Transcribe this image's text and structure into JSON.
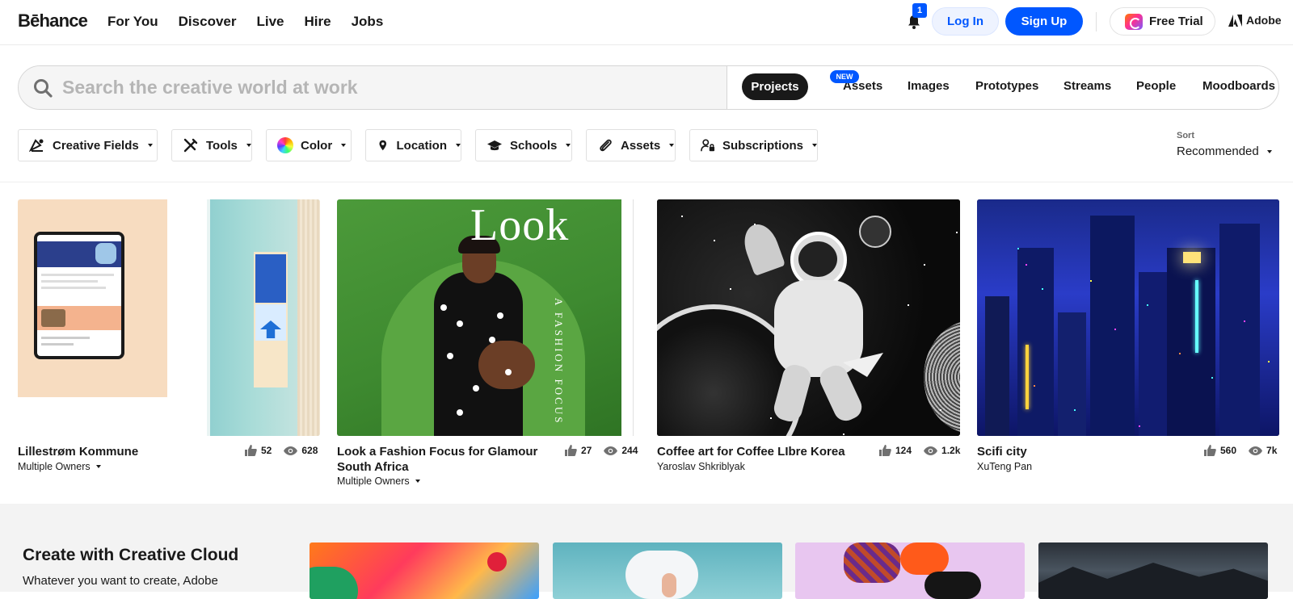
{
  "nav": {
    "logo": "Bēhance",
    "links": [
      "For You",
      "Discover",
      "Live",
      "Hire",
      "Jobs"
    ],
    "notification_count": "1",
    "login_label": "Log In",
    "signup_label": "Sign Up",
    "trial_label": "Free Trial",
    "adobe_label": "Adobe"
  },
  "search": {
    "placeholder": "Search the creative world at work",
    "tabs": [
      "Projects",
      "Assets",
      "Images",
      "Prototypes",
      "Streams",
      "People",
      "Moodboards"
    ],
    "active_tab": "Projects",
    "new_badge": "NEW"
  },
  "filters": [
    "Creative Fields",
    "Tools",
    "Color",
    "Location",
    "Schools",
    "Assets",
    "Subscriptions"
  ],
  "sort": {
    "label": "Sort",
    "value": "Recommended"
  },
  "cards": [
    {
      "title": "Lillestrøm Kommune",
      "owner": "Multiple Owners",
      "owner_dropdown": true,
      "likes": "52",
      "views": "628"
    },
    {
      "title": "Look a Fashion Focus for Glamour South Africa",
      "owner": "Multiple Owners",
      "owner_dropdown": true,
      "likes": "27",
      "views": "244",
      "image_text": "Look",
      "image_vertical_text": "A FASHION FOCUS"
    },
    {
      "title": "Coffee art for Coffee LIbre Korea",
      "owner": "Yaroslav Shkriblyak",
      "likes": "124",
      "views": "1.2k"
    },
    {
      "title": "Scifi city",
      "owner": "XuTeng Pan",
      "likes": "560",
      "views": "7k"
    }
  ],
  "promo": {
    "title": "Create with Creative Cloud",
    "subtitle": "Whatever you want to create, Adobe"
  },
  "colors": {
    "accent": "#0057ff",
    "text": "#191919",
    "placeholder": "#b5b5b5"
  }
}
